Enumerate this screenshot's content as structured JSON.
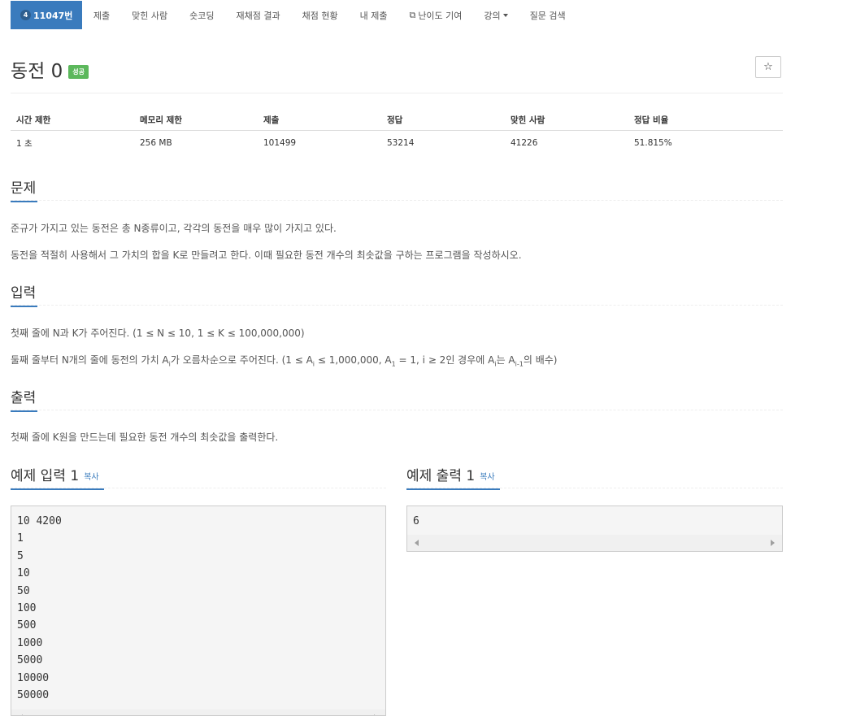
{
  "nav": {
    "problem_tier": "4",
    "items": [
      "11047번",
      "제출",
      "맞힌 사람",
      "숏코딩",
      "재채점 결과",
      "채점 현황",
      "내 제출",
      "난이도 기여",
      "강의",
      "질문 검색"
    ]
  },
  "problem": {
    "title": "동전 0",
    "status_badge": "성공",
    "star": "☆"
  },
  "info": {
    "headers": [
      "시간 제한",
      "메모리 제한",
      "제출",
      "정답",
      "맞힌 사람",
      "정답 비율"
    ],
    "values": [
      "1 초",
      "256 MB",
      "101499",
      "53214",
      "41226",
      "51.815%"
    ]
  },
  "sections": {
    "description": {
      "heading": "문제",
      "p1": "준규가 가지고 있는 동전은 총 N종류이고, 각각의 동전을 매우 많이 가지고 있다.",
      "p2": "동전을 적절히 사용해서 그 가치의 합을 K로 만들려고 한다. 이때 필요한 동전 개수의 최솟값을 구하는 프로그램을 작성하시오."
    },
    "input": {
      "heading": "입력",
      "p1": "첫째 줄에 N과 K가 주어진다. (1 ≤ N ≤ 10, 1 ≤ K ≤ 100,000,000)",
      "p2_a": "둘째 줄부터 N개의 줄에 동전의 가치 A",
      "p2_b": "가 오름차순으로 주어진다. (1 ≤ A",
      "p2_c": " ≤ 1,000,000, A",
      "p2_d": " = 1, i ≥ 2인 경우에 A",
      "p2_e": "는 A",
      "p2_f": "의 배수)",
      "sub_i": "i",
      "sub_1": "1",
      "sub_im1": "i-1"
    },
    "output": {
      "heading": "출력",
      "p1": "첫째 줄에 K원을 만드는데 필요한 동전 개수의 최솟값을 출력한다."
    }
  },
  "samples": {
    "copy_label": "복사",
    "input": {
      "heading": "예제 입력 1",
      "text": "10 4200\n1\n5\n10\n50\n100\n500\n1000\n5000\n10000\n50000"
    },
    "output": {
      "heading": "예제 출력 1",
      "text": "6"
    }
  }
}
